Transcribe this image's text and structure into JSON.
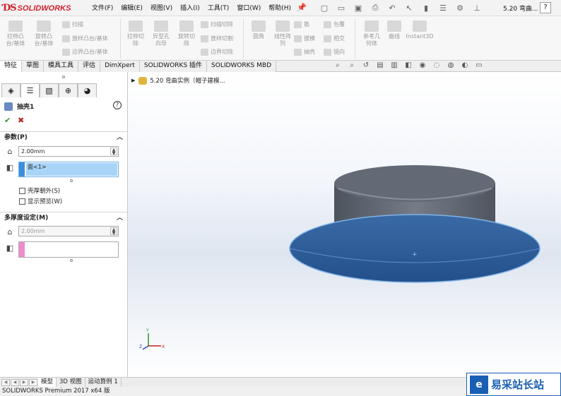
{
  "app": {
    "logo": "SOLIDWORKS",
    "doc_title": "5.20 弯曲...",
    "help": "?"
  },
  "menus": [
    "文件(F)",
    "编辑(E)",
    "视图(V)",
    "插入(I)",
    "工具(T)",
    "窗口(W)",
    "帮助(H)"
  ],
  "ribbon": {
    "big": [
      "拉伸凸\n台/基体",
      "旋转凸\n台/基体",
      "拉伸切\n除",
      "异型孔\n向导",
      "旋转切\n除",
      "圆角",
      "线性阵\n列",
      "参考几\n何体",
      "曲线",
      "Instant3D"
    ],
    "small": [
      "扫描",
      "放样凸台/基体",
      "边界凸台/基体",
      "扫描切除",
      "放样切割",
      "边界切除",
      "筋",
      "包覆",
      "拔模",
      "相交",
      "抽壳",
      "镜向"
    ]
  },
  "tabs": [
    "特征",
    "草图",
    "模具工具",
    "评估",
    "DimXpert",
    "SOLIDWORKS 插件",
    "SOLIDWORKS MBD"
  ],
  "panel": {
    "feature_title": "抽壳1",
    "params_header": "参数(P)",
    "thickness": "2.00mm",
    "faces_item": "面<1>",
    "shell_outward": "壳厚朝外(S)",
    "show_preview": "显示预览(W)",
    "multi_header": "多厚度设定(M)",
    "multi_thickness": "2.00mm"
  },
  "tree": {
    "root": "5.20 弯曲实例（帽子建模..."
  },
  "bottom_tabs": [
    "模型",
    "3D 视图",
    "运动算例 1"
  ],
  "status": "SOLIDWORKS Premium 2017 x64 版",
  "watermark": "易采站长站",
  "colors": {
    "accent": "#d0202a",
    "face_blue": "#2f5e99",
    "body_gray": "#676d78"
  }
}
